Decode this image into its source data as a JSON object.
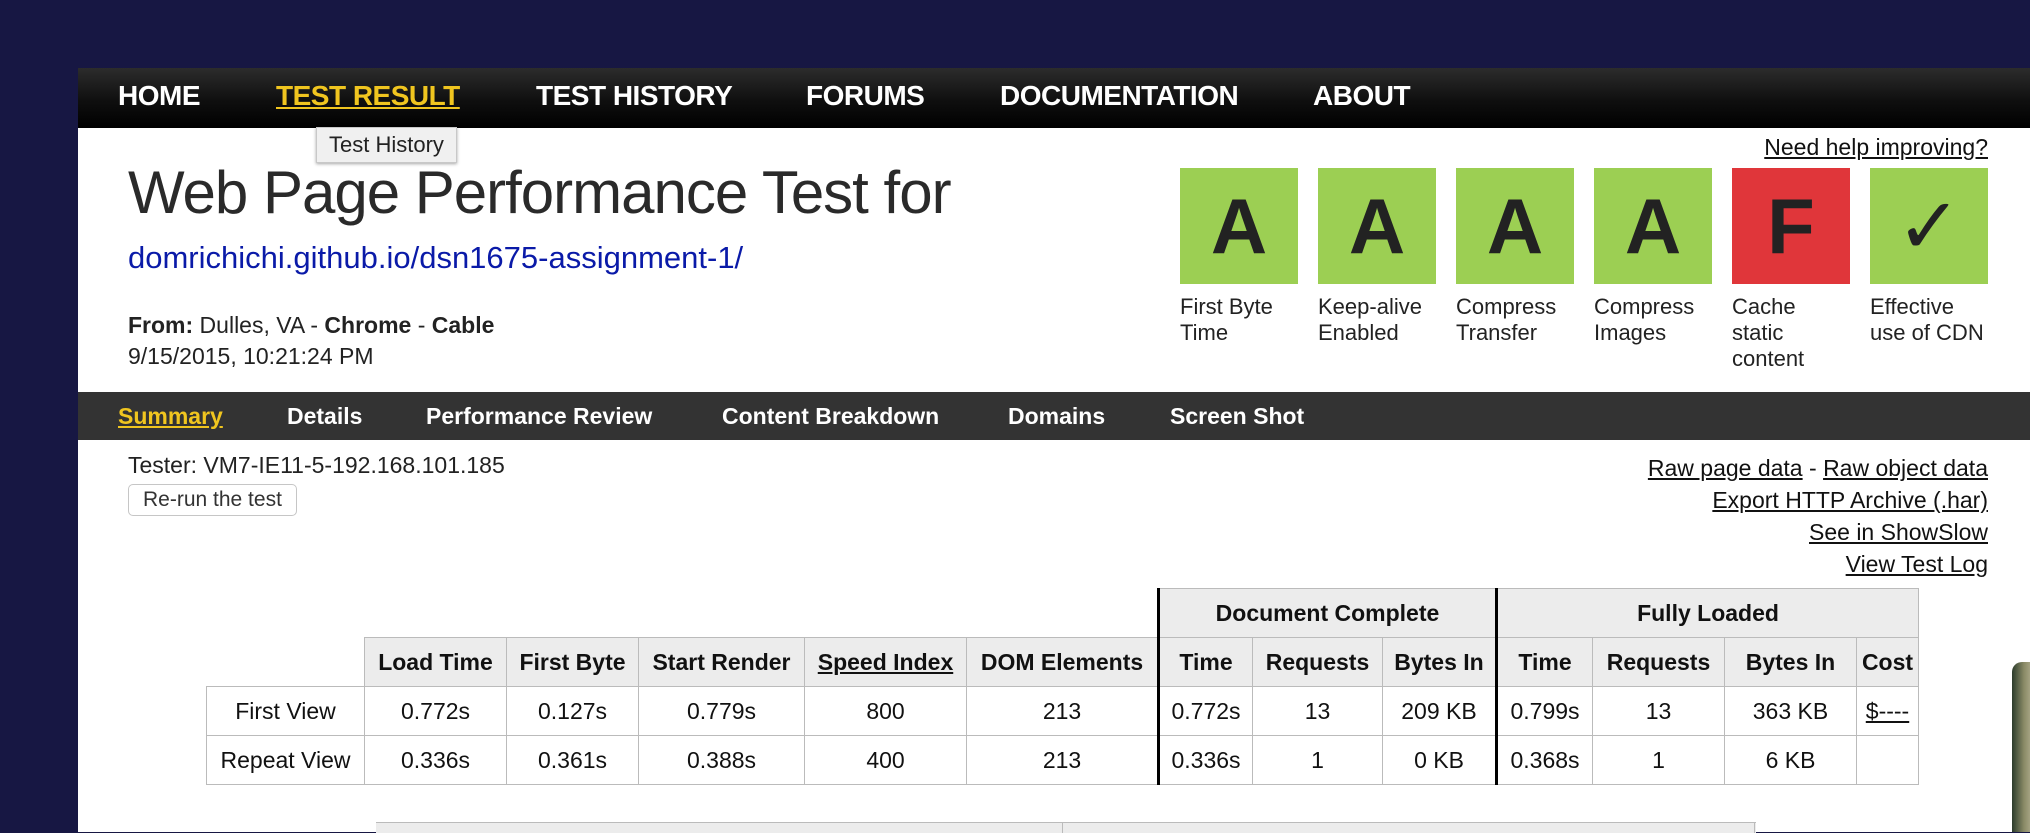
{
  "nav": {
    "items": [
      "HOME",
      "TEST RESULT",
      "TEST HISTORY",
      "FORUMS",
      "DOCUMENTATION",
      "ABOUT"
    ],
    "active": "TEST RESULT"
  },
  "tooltip": "Test History",
  "header": {
    "title": "Web Page Performance Test for",
    "url": "domrichichi.github.io/dsn1675-assignment-1/",
    "from_label": "From:",
    "location": " Dulles, VA - ",
    "browser": "Chrome",
    "separator": " - ",
    "connection": "Cable",
    "datetime": "9/15/2015, 10:21:24 PM",
    "help_link": "Need help improving?"
  },
  "grades": [
    {
      "grade": "A",
      "label": "First Byte Time",
      "color": "#9ccf53"
    },
    {
      "grade": "A",
      "label": "Keep-alive Enabled",
      "color": "#9ccf53"
    },
    {
      "grade": "A",
      "label": "Compress Transfer",
      "color": "#9ccf53"
    },
    {
      "grade": "A",
      "label": "Compress Images",
      "color": "#9ccf53"
    },
    {
      "grade": "F",
      "label": "Cache static content",
      "color": "#e0363a"
    },
    {
      "grade": "✓",
      "label": "Effective use of CDN",
      "color": "#9ccf53"
    }
  ],
  "subnav": {
    "items": [
      "Summary",
      "Details",
      "Performance Review",
      "Content Breakdown",
      "Domains",
      "Screen Shot"
    ],
    "active": "Summary"
  },
  "tester": "Tester: VM7-IE11-5-192.168.101.185",
  "rerun_button": "Re-run the test",
  "links": {
    "raw_page": "Raw page data",
    "dash": " - ",
    "raw_object": "Raw object data",
    "export_har": "Export HTTP Archive (.har)",
    "showslow": "See in ShowSlow",
    "test_log": "View Test Log"
  },
  "table": {
    "group_headers": [
      "Document Complete",
      "Fully Loaded"
    ],
    "columns": [
      "Load Time",
      "First Byte",
      "Start Render",
      "Speed Index",
      "DOM Elements",
      "Time",
      "Requests",
      "Bytes In",
      "Time",
      "Requests",
      "Bytes In",
      "Cost"
    ],
    "rows": [
      {
        "label": "First View",
        "cells": [
          "0.772s",
          "0.127s",
          "0.779s",
          "800",
          "213",
          "0.772s",
          "13",
          "209 KB",
          "0.799s",
          "13",
          "363 KB",
          "$----"
        ]
      },
      {
        "label": "Repeat View",
        "cells": [
          "0.336s",
          "0.361s",
          "0.388s",
          "400",
          "213",
          "0.336s",
          "1",
          "0 KB",
          "0.368s",
          "1",
          "6 KB",
          ""
        ]
      }
    ]
  }
}
